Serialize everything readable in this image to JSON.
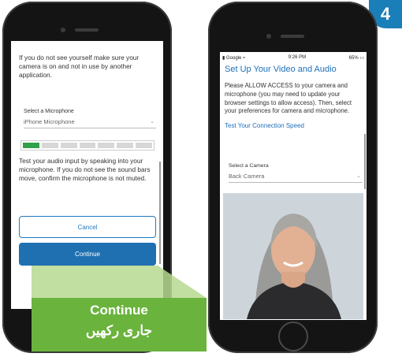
{
  "step": {
    "number": "4"
  },
  "left_phone": {
    "intro_text": "If you do not see yourself make sure your camera is on and not in use by another application.",
    "mic_label": "Select a Microphone",
    "mic_value": "iPhone Microphone",
    "audio_level": {
      "active_bars": 1,
      "total_bars": 7
    },
    "help_text": "Test your audio input by speaking into your microphone. If you do not see the sound bars move, confirm the microphone is not muted.",
    "cancel_label": "Cancel",
    "continue_label": "Continue"
  },
  "callout": {
    "line1": "Continue",
    "line2": "جاری رکھیں"
  },
  "right_phone": {
    "status": {
      "carrier": "Google",
      "time": "9:26 PM",
      "battery": "65%"
    },
    "title": "Set Up Your Video and Audio",
    "instructions": "Please ALLOW ACCESS to your camera and microphone (you may need to update your browser settings to allow access). Then, select your preferences for camera and microphone.",
    "test_link": "Test Your Connection Speed",
    "camera_label": "Select a Camera",
    "camera_value": "Back Camera"
  },
  "colors": {
    "accent": "#1f70b0",
    "callout": "#6ab33d",
    "level": "#2fa24a",
    "badge": "#1a7fb8"
  }
}
